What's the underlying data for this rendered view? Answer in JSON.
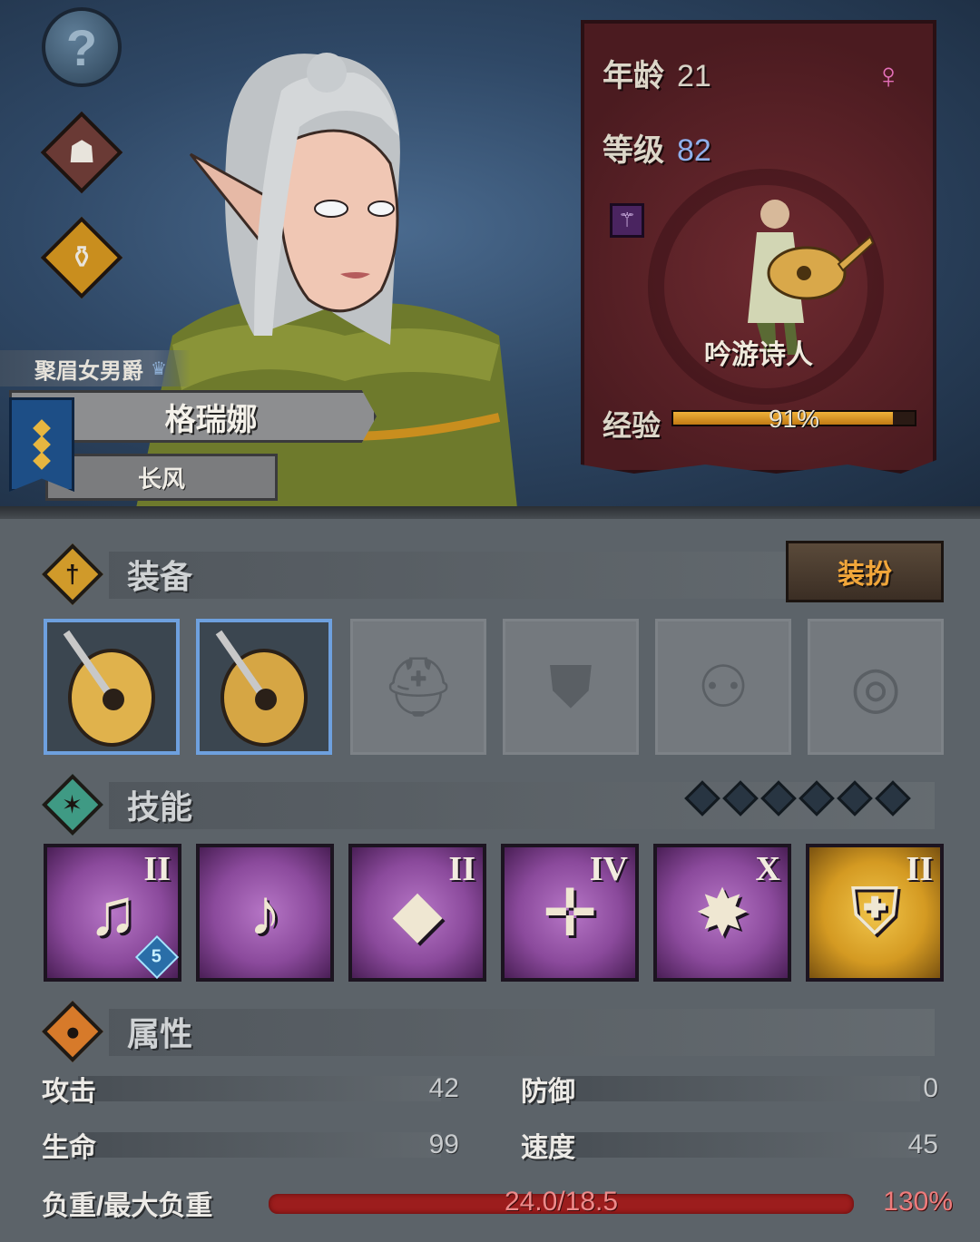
{
  "sidebar": {
    "help_label": "?",
    "buttons": [
      {
        "name": "help-icon"
      },
      {
        "name": "character-bust-icon"
      },
      {
        "name": "potion-pot-icon"
      }
    ]
  },
  "hero": {
    "title": "聚眉女男爵",
    "name": "格瑞娜",
    "nickname": "长风",
    "banner_color": "#1d4e86"
  },
  "info_card": {
    "age_label": "年龄",
    "age": "21",
    "gender_symbol": "⚥",
    "level_label": "等级",
    "level": "82",
    "class_name": "吟游诗人",
    "exp_label": "经验",
    "exp_percent": 91,
    "exp_text": "91%"
  },
  "equipment": {
    "title": "装备",
    "dress_button": "装扮",
    "slots": [
      {
        "type": "lute",
        "filled": true
      },
      {
        "type": "lute",
        "filled": true
      },
      {
        "type": "helmet",
        "filled": false
      },
      {
        "type": "armor",
        "filled": false
      },
      {
        "type": "boots",
        "filled": false
      },
      {
        "type": "ring",
        "filled": false
      }
    ]
  },
  "skills": {
    "title": "技能",
    "diamond_count": 6,
    "items": [
      {
        "rank": "II",
        "glyph": "♫",
        "level": "5",
        "color": "purple"
      },
      {
        "rank": "",
        "glyph": "♪",
        "level": "",
        "color": "purple"
      },
      {
        "rank": "II",
        "glyph": "◆",
        "level": "",
        "color": "purple"
      },
      {
        "rank": "IV",
        "glyph": "✛",
        "level": "",
        "color": "purple"
      },
      {
        "rank": "X",
        "glyph": "✸",
        "level": "",
        "color": "purple"
      },
      {
        "rank": "II",
        "glyph": "⛨",
        "level": "",
        "color": "gold"
      }
    ]
  },
  "attributes": {
    "title": "属性",
    "attack_label": "攻击",
    "attack": "42",
    "defense_label": "防御",
    "defense": "0",
    "hp_label": "生命",
    "hp": "99",
    "speed_label": "速度",
    "speed": "45",
    "load_label": "负重/最大负重",
    "load_value": "24.0/18.5",
    "load_percent": "130%"
  }
}
